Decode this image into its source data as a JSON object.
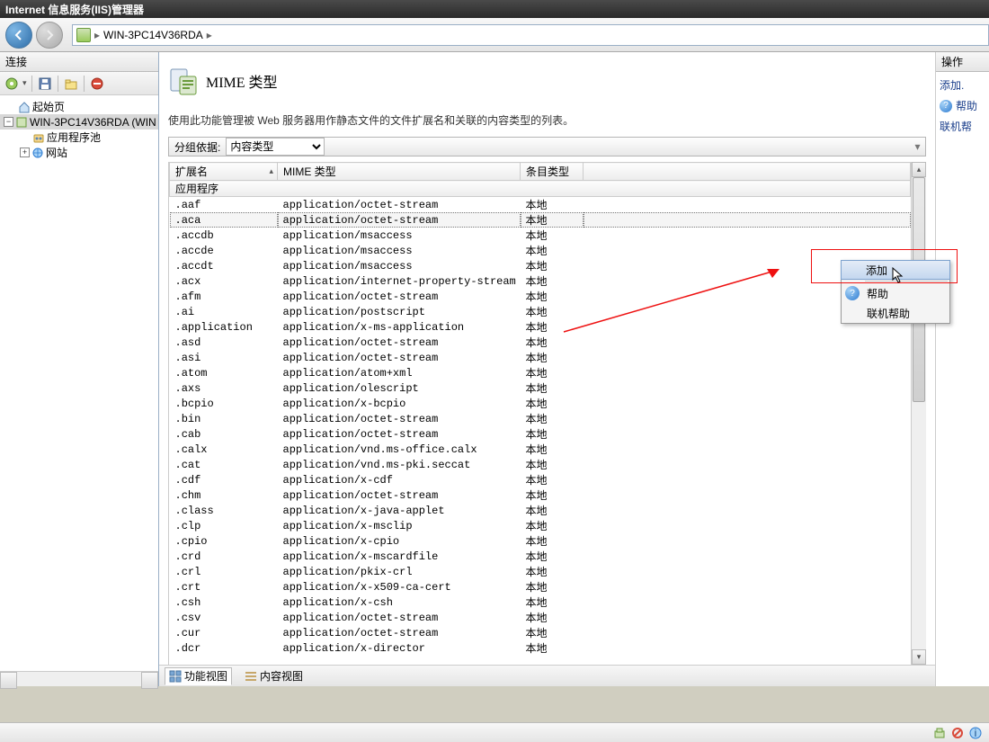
{
  "window": {
    "title": "Internet 信息服务(IIS)管理器"
  },
  "breadcrumb": {
    "server_name": "WIN-3PC14V36RDA",
    "sep": "▸"
  },
  "left": {
    "title": "连接",
    "tree": {
      "start_page": "起始页",
      "server_node": "WIN-3PC14V36RDA (WIN",
      "app_pools": "应用程序池",
      "sites": "网站"
    }
  },
  "center": {
    "title": "MIME 类型",
    "desc": "使用此功能管理被 Web 服务器用作静态文件的文件扩展名和关联的内容类型的列表。",
    "group_label": "分组依据:",
    "group_value": "内容类型",
    "columns": {
      "ext": "扩展名",
      "mime": "MIME 类型",
      "entry": "条目类型"
    },
    "group_header": "应用程序",
    "rows": [
      {
        "ext": ".aaf",
        "mime": "application/octet-stream",
        "entry": "本地"
      },
      {
        "ext": ".aca",
        "mime": "application/octet-stream",
        "entry": "本地",
        "selected": true
      },
      {
        "ext": ".accdb",
        "mime": "application/msaccess",
        "entry": "本地"
      },
      {
        "ext": ".accde",
        "mime": "application/msaccess",
        "entry": "本地"
      },
      {
        "ext": ".accdt",
        "mime": "application/msaccess",
        "entry": "本地"
      },
      {
        "ext": ".acx",
        "mime": "application/internet-property-stream",
        "entry": "本地"
      },
      {
        "ext": ".afm",
        "mime": "application/octet-stream",
        "entry": "本地"
      },
      {
        "ext": ".ai",
        "mime": "application/postscript",
        "entry": "本地"
      },
      {
        "ext": ".application",
        "mime": "application/x-ms-application",
        "entry": "本地"
      },
      {
        "ext": ".asd",
        "mime": "application/octet-stream",
        "entry": "本地"
      },
      {
        "ext": ".asi",
        "mime": "application/octet-stream",
        "entry": "本地"
      },
      {
        "ext": ".atom",
        "mime": "application/atom+xml",
        "entry": "本地"
      },
      {
        "ext": ".axs",
        "mime": "application/olescript",
        "entry": "本地"
      },
      {
        "ext": ".bcpio",
        "mime": "application/x-bcpio",
        "entry": "本地"
      },
      {
        "ext": ".bin",
        "mime": "application/octet-stream",
        "entry": "本地"
      },
      {
        "ext": ".cab",
        "mime": "application/octet-stream",
        "entry": "本地"
      },
      {
        "ext": ".calx",
        "mime": "application/vnd.ms-office.calx",
        "entry": "本地"
      },
      {
        "ext": ".cat",
        "mime": "application/vnd.ms-pki.seccat",
        "entry": "本地"
      },
      {
        "ext": ".cdf",
        "mime": "application/x-cdf",
        "entry": "本地"
      },
      {
        "ext": ".chm",
        "mime": "application/octet-stream",
        "entry": "本地"
      },
      {
        "ext": ".class",
        "mime": "application/x-java-applet",
        "entry": "本地"
      },
      {
        "ext": ".clp",
        "mime": "application/x-msclip",
        "entry": "本地"
      },
      {
        "ext": ".cpio",
        "mime": "application/x-cpio",
        "entry": "本地"
      },
      {
        "ext": ".crd",
        "mime": "application/x-mscardfile",
        "entry": "本地"
      },
      {
        "ext": ".crl",
        "mime": "application/pkix-crl",
        "entry": "本地"
      },
      {
        "ext": ".crt",
        "mime": "application/x-x509-ca-cert",
        "entry": "本地"
      },
      {
        "ext": ".csh",
        "mime": "application/x-csh",
        "entry": "本地"
      },
      {
        "ext": ".csv",
        "mime": "application/octet-stream",
        "entry": "本地"
      },
      {
        "ext": ".cur",
        "mime": "application/octet-stream",
        "entry": "本地"
      },
      {
        "ext": ".dcr",
        "mime": "application/x-director",
        "entry": "本地"
      }
    ],
    "tabs": {
      "features": "功能视图",
      "content": "内容视图"
    }
  },
  "right": {
    "title": "操作",
    "add": "添加.",
    "help": "帮助",
    "online": "联机帮"
  },
  "context_menu": {
    "add": "添加",
    "help": "帮助",
    "online_help": "联机帮助"
  }
}
